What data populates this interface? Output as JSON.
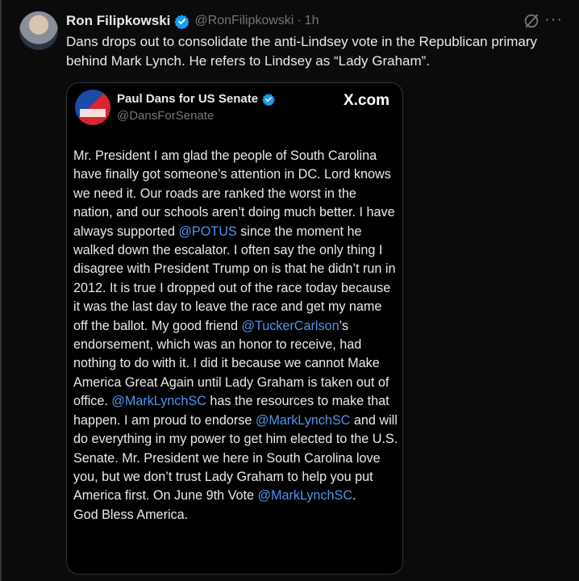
{
  "post": {
    "author_name": "Ron Filipkowski",
    "handle": "@RonFilipkowski",
    "separator": "·",
    "time": "1h",
    "text": "Dans drops out to consolidate the anti-Lindsey vote in the Republican primary behind Mark Lynch. He refers to Lindsey as “Lady Graham”.",
    "icons": [
      "verified-badge-icon",
      "grok-icon",
      "more-options-icon"
    ]
  },
  "quote": {
    "author_name": "Paul Dans for US Senate",
    "handle": "@DansForSenate",
    "source": "X.com",
    "segments": [
      {
        "text": "Mr. President I am glad the people of South Carolina have finally got someone’s attention in DC. Lord knows we need it. Our roads are ranked the worst in the nation, and our schools aren’t doing much better. I have always supported "
      },
      {
        "text": "@POTUS",
        "mention": true
      },
      {
        "text": " since the moment he walked down the escalator. I often say the only thing I disagree with President Trump on is that he didn’t run in 2012. It is true I dropped out of the race today because it was the last day to leave the race and get my name off the ballot. My good friend "
      },
      {
        "text": "@TuckerCarlson",
        "mention": true
      },
      {
        "text": "’s endorsement, which was an honor to receive, had nothing to do with it. I did it because we cannot Make America Great Again until Lady Graham is taken out of office. "
      },
      {
        "text": "@MarkLynchSC",
        "mention": true
      },
      {
        "text": " has the resources to make that happen. I am proud to endorse "
      },
      {
        "text": "@MarkLynchSC",
        "mention": true
      },
      {
        "text": " and will do everything in my power to get him elected to the U.S. Senate. Mr. President we here in South Carolina love you, but we don’t trust Lady Graham to help you put America first. On June 9th Vote "
      },
      {
        "text": "@MarkLynchSC",
        "mention": true
      },
      {
        "text": ".\nGod Bless America."
      }
    ]
  },
  "colors": {
    "background": "#0b0b0c",
    "text": "#e7e9ea",
    "muted": "#71767b",
    "mention": "#4f95e8",
    "verified": "#1d9bf0",
    "border": "#2f3336"
  }
}
